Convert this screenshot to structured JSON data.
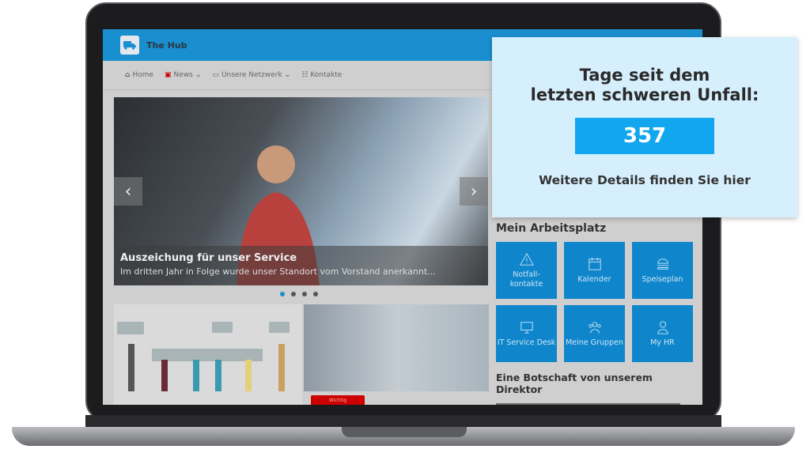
{
  "app": {
    "title": "The Hub",
    "accent": "#1a8fd0"
  },
  "nav": {
    "items": [
      {
        "label": "Home",
        "icon": "home-icon"
      },
      {
        "label": "News",
        "icon": "newspaper-icon",
        "dropdown": true
      },
      {
        "label": "Unsere Netzwerk",
        "icon": "briefcase-icon",
        "dropdown": true
      },
      {
        "label": "Kontakte",
        "icon": "contacts-icon"
      }
    ]
  },
  "carousel": {
    "title": "Auszeichung für unser Service",
    "subtitle": "Im dritten Jahr in Folge wurde unser Standort vom Vorstand anerkannt...",
    "slides": 4,
    "active": 1
  },
  "news": {
    "badge": "Wichtig"
  },
  "workplace": {
    "title": "Mein Arbeitsplatz",
    "tiles": [
      {
        "label": "Notfall-\nkontakte",
        "icon": "warning-icon"
      },
      {
        "label": "Kalender",
        "icon": "calendar-icon"
      },
      {
        "label": "Speiseplan",
        "icon": "burger-icon"
      },
      {
        "label": "IT Service Desk",
        "icon": "monitor-icon"
      },
      {
        "label": "Meine Gruppen",
        "icon": "group-icon"
      },
      {
        "label": "My HR",
        "icon": "user-icon"
      }
    ]
  },
  "director": {
    "title": "Eine Botschaft von unserem Direktor"
  },
  "overlay": {
    "title_line1": "Tage seit dem",
    "title_line2": "letzten schweren Unfall:",
    "count": "357",
    "link": "Weitere Details finden Sie hier",
    "bg": "#d6effd",
    "count_bg": "#12a6ee"
  }
}
